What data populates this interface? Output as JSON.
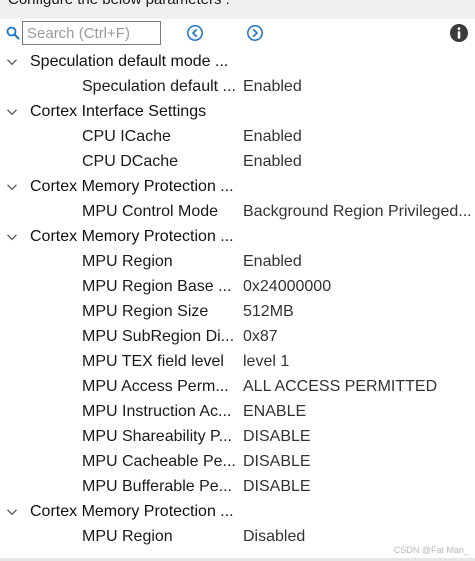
{
  "header": {
    "title": "Configure the below parameters :"
  },
  "toolbar": {
    "search_placeholder": "Search (Ctrl+F)",
    "search_value": "",
    "icons": {
      "search": "search-icon",
      "prev": "chevron-left-circle-icon",
      "next": "chevron-right-circle-icon",
      "info": "info-icon"
    },
    "accent_color": "#1a73c8"
  },
  "groups": [
    {
      "label": "Speculation default mode ...",
      "params": [
        {
          "name": "Speculation default ...",
          "value": "Enabled"
        }
      ]
    },
    {
      "label": "Cortex Interface Settings",
      "params": [
        {
          "name": "CPU ICache",
          "value": "Enabled"
        },
        {
          "name": "CPU DCache",
          "value": "Enabled"
        }
      ]
    },
    {
      "label": "Cortex Memory Protection ...",
      "params": [
        {
          "name": "MPU Control Mode",
          "value": "Background Region Privileged..."
        }
      ]
    },
    {
      "label": "Cortex Memory Protection ...",
      "params": [
        {
          "name": "MPU Region",
          "value": "Enabled"
        },
        {
          "name": "MPU Region Base ...",
          "value": "0x24000000"
        },
        {
          "name": "MPU Region Size",
          "value": "512MB"
        },
        {
          "name": "MPU SubRegion Di...",
          "value": "0x87"
        },
        {
          "name": "MPU TEX field level",
          "value": "level 1"
        },
        {
          "name": "MPU Access Perm...",
          "value": "ALL ACCESS PERMITTED"
        },
        {
          "name": "MPU Instruction Ac...",
          "value": "ENABLE"
        },
        {
          "name": "MPU Shareability P...",
          "value": "DISABLE"
        },
        {
          "name": "MPU Cacheable Pe...",
          "value": "DISABLE"
        },
        {
          "name": "MPU Bufferable  Pe...",
          "value": "DISABLE"
        }
      ]
    },
    {
      "label": "Cortex Memory Protection ...",
      "params": [
        {
          "name": "MPU Region",
          "value": "Disabled"
        }
      ]
    }
  ],
  "watermark": "CSDN @Fat Man_"
}
